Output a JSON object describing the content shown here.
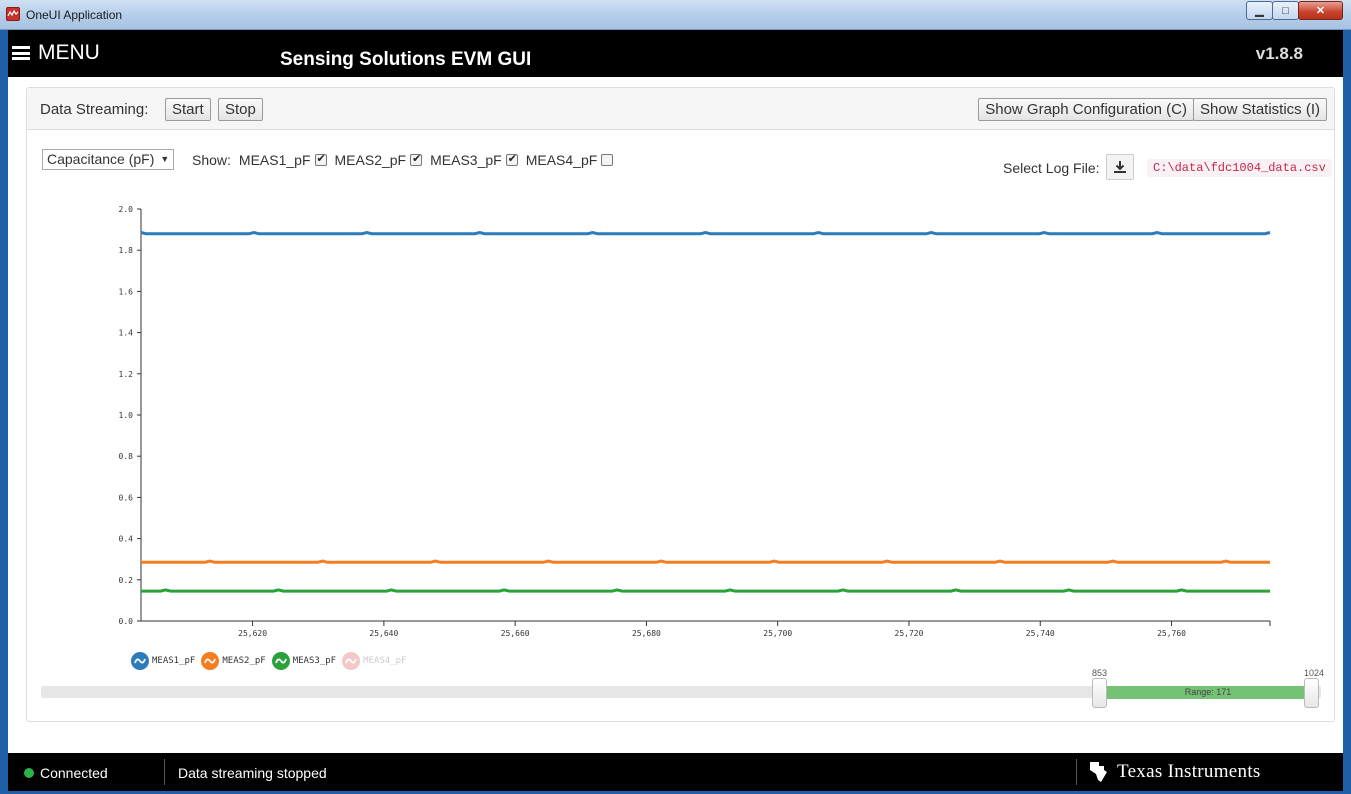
{
  "window": {
    "title": "OneUI Application"
  },
  "header": {
    "menu_label": "MENU",
    "title": "Sensing Solutions EVM GUI",
    "version": "v1.8.8"
  },
  "toolbar": {
    "data_streaming_label": "Data Streaming:",
    "start_label": "Start",
    "stop_label": "Stop",
    "graph_config_label": "Show Graph Configuration (C)",
    "statistics_label": "Show Statistics (I)"
  },
  "controls": {
    "unit_selected": "Capacitance (pF)",
    "show_label": "Show:",
    "measurements": [
      {
        "label": "MEAS1_pF",
        "checked": true
      },
      {
        "label": "MEAS2_pF",
        "checked": true
      },
      {
        "label": "MEAS3_pF",
        "checked": true
      },
      {
        "label": "MEAS4_pF",
        "checked": false
      }
    ],
    "log_label": "Select Log File:",
    "log_path": "C:\\data\\fdc1004_data.csv"
  },
  "colors": {
    "meas1": "#2c7bba",
    "meas2": "#f57c1f",
    "meas3": "#2aa13a",
    "meas4": "#f4c8c8",
    "range_fill": "#74c374",
    "connected": "#2bb24c"
  },
  "chart_data": {
    "type": "line",
    "xlabel": "",
    "ylabel": "",
    "xlim": [
      25603,
      25775
    ],
    "ylim": [
      0.0,
      2.0
    ],
    "y_ticks": [
      "0.0",
      "0.2",
      "0.4",
      "0.6",
      "0.8",
      "1.0",
      "1.2",
      "1.4",
      "1.6",
      "1.8",
      "2.0"
    ],
    "x_ticks": [
      "25,620",
      "25,640",
      "25,660",
      "25,680",
      "25,700",
      "25,720",
      "25,740",
      "25,760"
    ],
    "legend_position": "bottom-left",
    "series": [
      {
        "name": "MEAS1_pF",
        "value": 1.88,
        "visible": true
      },
      {
        "name": "MEAS2_pF",
        "value": 0.285,
        "visible": true
      },
      {
        "name": "MEAS3_pF",
        "value": 0.145,
        "visible": true
      },
      {
        "name": "MEAS4_pF",
        "value": null,
        "visible": false
      }
    ]
  },
  "range": {
    "min": "0",
    "low": "853",
    "high": "1024",
    "label": "Range: 171"
  },
  "status": {
    "connection": "Connected",
    "streaming": "Data streaming stopped",
    "company": "Texas Instruments"
  }
}
